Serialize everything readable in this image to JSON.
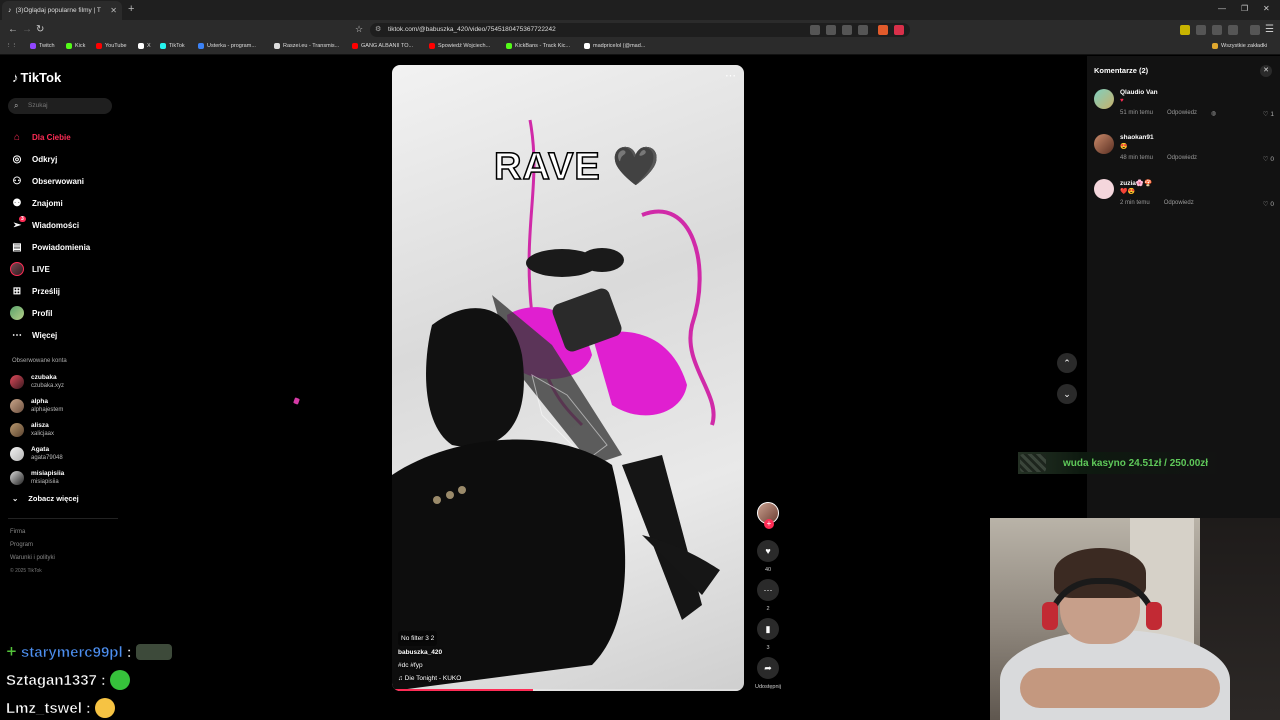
{
  "browser": {
    "tab_title": "(3)Oglądaj popularne filmy | T",
    "url": "tiktok.com/@babuszka_420/video/7545180475367722242",
    "bookmarks": [
      "Twitch",
      "Kick",
      "YouTube",
      "X",
      "TikTok",
      "Usterka - program...",
      "Raszei.eu - Transmis...",
      "GANG ALBANII TO...",
      "Spowiedź Wojciech...",
      "KickBans - Track Kic...",
      "madpricelol (@mad..."
    ],
    "all_bookmarks": "Wszystkie zakładki"
  },
  "tiktok": {
    "logo": "TikTok",
    "search_placeholder": "Szukaj",
    "nav": [
      "Dla Ciebie",
      "Odkryj",
      "Obserwowani",
      "Znajomi",
      "Wiadomości",
      "Powiadomienia",
      "LIVE",
      "Prześlij",
      "Profil",
      "Więcej"
    ],
    "messages_badge": "3",
    "followed_title": "Obserwowane konta",
    "followed": [
      {
        "name": "czubaka",
        "handle": "czubaka.xyz"
      },
      {
        "name": "alpha",
        "handle": "alphajestem"
      },
      {
        "name": "alisza",
        "handle": "xalicjaax"
      },
      {
        "name": "Agata",
        "handle": "agata79048"
      },
      {
        "name": "misiapisiia",
        "handle": "misiapisiia"
      }
    ],
    "see_more": "Zobacz więcej",
    "footer": [
      "Firma",
      "Program",
      "Warunki i polityki"
    ],
    "copyright": "© 2025 TikTok"
  },
  "video": {
    "overlay_text": "RAVE 🖤",
    "filter_label": "No filter 3",
    "filter_count": "2",
    "author": "babuszka_420",
    "tags": "#dc #fyp",
    "music": "♫ Die Tonight - KUKO",
    "progress": 0.4
  },
  "actions": {
    "likes": "40",
    "comments": "2",
    "saves": "3",
    "share_label": "Udostępnij"
  },
  "comments_panel": {
    "title": "Komentarze (2)",
    "items": [
      {
        "user": "Qlaudio Van",
        "text": "♥",
        "time": "51 min temu",
        "reply": "Odpowiedz",
        "likes": "1"
      },
      {
        "user": "shaokan91",
        "text": "😍",
        "time": "48 min temu",
        "reply": "Odpowiedz",
        "likes": "0"
      },
      {
        "user": "zuzia🌸🍄",
        "text": "❤️😍",
        "time": "2 min temu",
        "reply": "Odpowiedz",
        "likes": "0"
      }
    ]
  },
  "stream_overlay": {
    "donation_text": "wuda kasyno 24.51zł / 250.00zł",
    "chat": [
      {
        "user": "starymerc99pl",
        "sep": ":",
        "color": "#4d8ff0"
      },
      {
        "user": "Sztagan1337",
        "sep": ":",
        "color": "#ffffff"
      },
      {
        "user": "Lmz_tswel",
        "sep": ":",
        "color": "#ffffff"
      }
    ]
  }
}
